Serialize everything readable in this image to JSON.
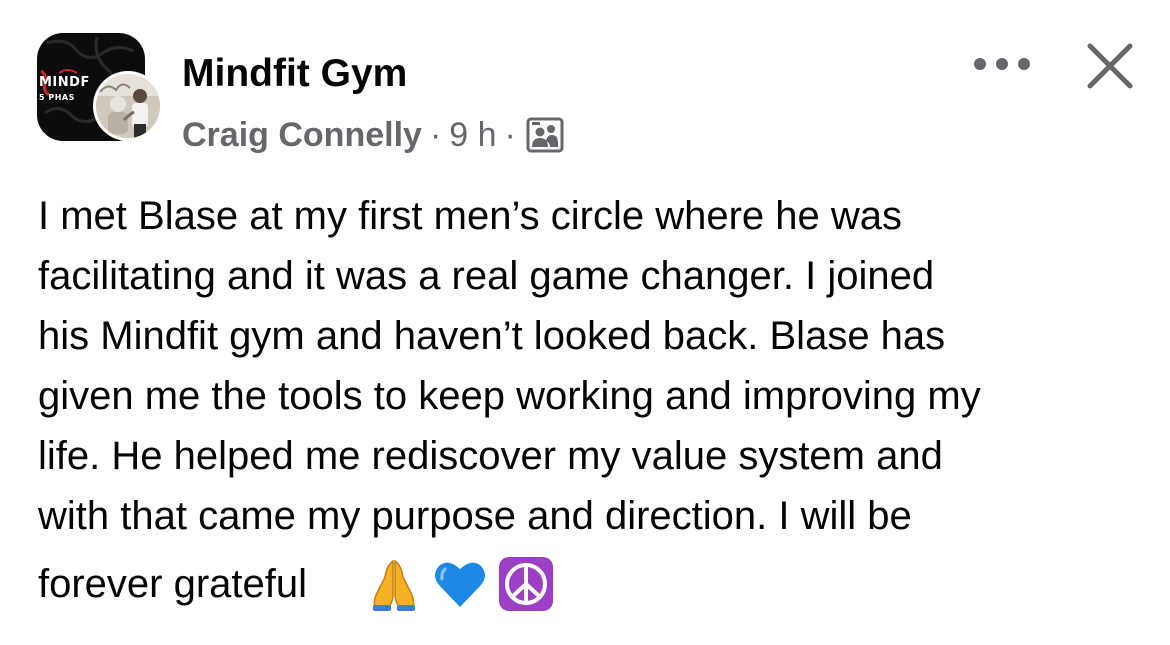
{
  "header": {
    "group_name": "Mindfit Gym",
    "group_logo_text": "MINDF",
    "group_logo_subtext": "5 PHAS",
    "author": "Craig Connelly",
    "separator": "·",
    "time": "9 h",
    "privacy_icon": "group-members-icon",
    "more_icon": "more-options-icon",
    "close_icon": "close-icon"
  },
  "post": {
    "lines": [
      "I met Blase at my first men’s circle where he was",
      "facilitating and it was a real game changer. I joined",
      "his Mindfit gym and haven’t looked back. Blase has",
      "given me the tools to keep working and improving my",
      "life. He helped me rediscover my value system and",
      "with that came my purpose and direction. I will be"
    ],
    "last_line": "forever grateful",
    "emojis": [
      "folded-hands-emoji",
      "blue-heart-emoji",
      "peace-symbol-emoji"
    ]
  },
  "colors": {
    "text_primary": "#050505",
    "text_secondary": "#65676b",
    "group_avatar_bg": "#0c0c0c",
    "logo_accent": "#c62828",
    "heart_blue": "#1e88e5",
    "peace_purple": "#9c3fc4"
  }
}
